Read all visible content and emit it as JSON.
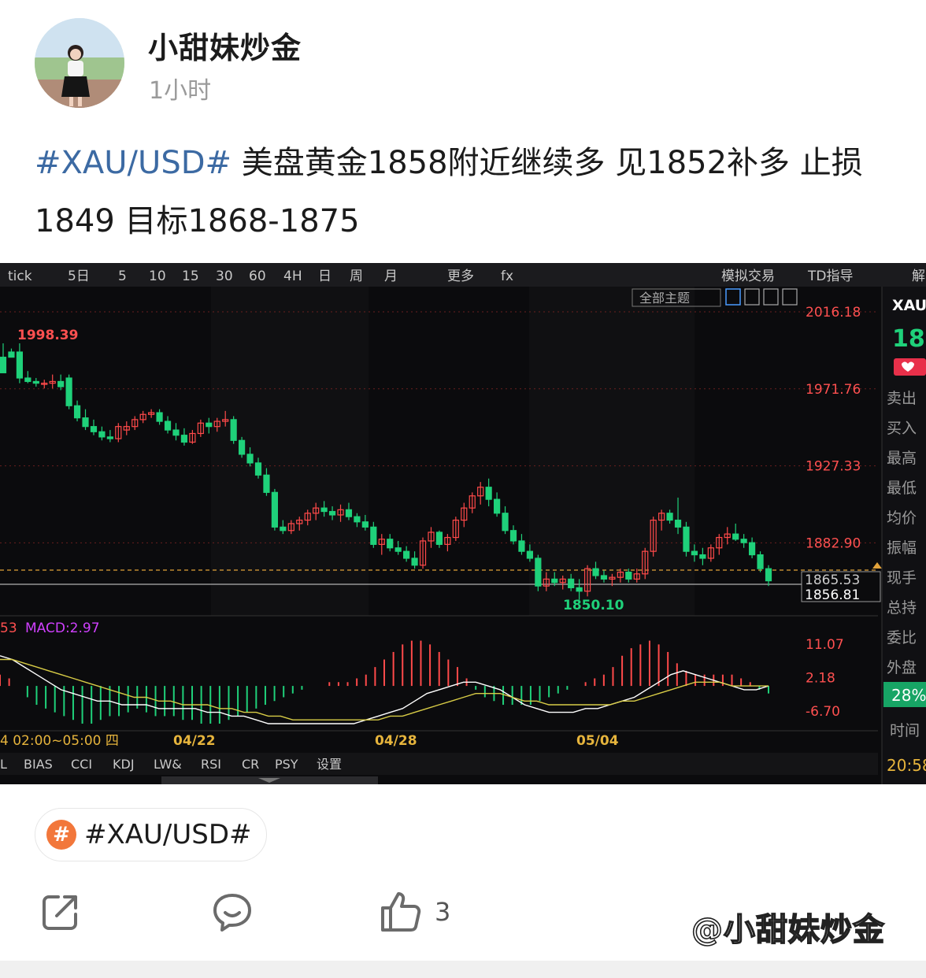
{
  "post": {
    "author": "小甜妹炒金",
    "time": "1小时",
    "hashtag": "#XAU/USD#",
    "body": " 美盘黄金1858附近继续多 见1852补多 止损1849 目标1868-1875"
  },
  "chart_toolbar": {
    "items": [
      "tick",
      "5日",
      "5",
      "10",
      "15",
      "30",
      "60",
      "4H",
      "日",
      "周",
      "月",
      "更多",
      "fx",
      "模拟交易",
      "TD指导",
      "解"
    ],
    "theme_button": "全部主题"
  },
  "chart_data": {
    "type": "candlestick",
    "symbol": "XAU",
    "price_axis_labels": [
      "2016.18",
      "1971.76",
      "1927.33",
      "1882.90"
    ],
    "current_price_label": "1865.53",
    "reference_price_label": "1856.81",
    "high_label": "1998.39",
    "low_label": "1850.10",
    "x_tick_labels": [
      "04/22",
      "04/28",
      "05/04"
    ],
    "time_range_label": "4 02:00~05:00 四",
    "macd_label": "MACD:2.97",
    "macd_left_value": "53",
    "macd_axis_labels": [
      "11.07",
      "2.18",
      "-6.70"
    ],
    "side_panel": {
      "symbol": "XAU",
      "price_partial": "18",
      "labels": [
        "卖出",
        "买入",
        "最高",
        "最低",
        "均价",
        "振幅",
        "现手",
        "总持",
        "委比",
        "外盘"
      ],
      "percent": "28%",
      "time_label": "时间",
      "time_value": "20:58"
    },
    "indicator_tabs": [
      "L",
      "BIAS",
      "CCI",
      "KDJ",
      "LW&",
      "RSI",
      "CR",
      "PSY",
      "设置"
    ],
    "candles": [
      [
        1990,
        1998,
        1985,
        1981
      ],
      [
        1993,
        1995,
        1990,
        1990
      ],
      [
        1993,
        1998,
        1975,
        1978
      ],
      [
        1978,
        1982,
        1975,
        1976
      ],
      [
        1976,
        1978,
        1973,
        1975
      ],
      [
        1975,
        1977,
        1972,
        1975
      ],
      [
        1975,
        1980,
        1972,
        1976
      ],
      [
        1976,
        1980,
        1971,
        1973
      ],
      [
        1978,
        1980,
        1960,
        1962
      ],
      [
        1962,
        1965,
        1953,
        1955
      ],
      [
        1955,
        1960,
        1948,
        1950
      ],
      [
        1950,
        1954,
        1945,
        1947
      ],
      [
        1947,
        1950,
        1942,
        1944
      ],
      [
        1944,
        1948,
        1941,
        1943
      ],
      [
        1943,
        1952,
        1941,
        1950
      ],
      [
        1948,
        1953,
        1945,
        1950
      ],
      [
        1950,
        1956,
        1948,
        1954
      ],
      [
        1954,
        1959,
        1952,
        1957
      ],
      [
        1957,
        1960,
        1955,
        1958
      ],
      [
        1958,
        1960,
        1951,
        1953
      ],
      [
        1953,
        1956,
        1946,
        1948
      ],
      [
        1948,
        1952,
        1942,
        1945
      ],
      [
        1945,
        1949,
        1939,
        1941
      ],
      [
        1941,
        1948,
        1940,
        1946
      ],
      [
        1946,
        1954,
        1944,
        1952
      ],
      [
        1952,
        1955,
        1946,
        1950
      ],
      [
        1950,
        1955,
        1947,
        1953
      ],
      [
        1953,
        1959,
        1950,
        1954
      ],
      [
        1954,
        1956,
        1940,
        1942
      ],
      [
        1942,
        1944,
        1932,
        1934
      ],
      [
        1934,
        1938,
        1927,
        1929
      ],
      [
        1929,
        1932,
        1920,
        1922
      ],
      [
        1922,
        1926,
        1910,
        1912
      ],
      [
        1912,
        1914,
        1890,
        1892
      ],
      [
        1892,
        1896,
        1888,
        1890
      ],
      [
        1890,
        1896,
        1888,
        1894
      ],
      [
        1894,
        1898,
        1890,
        1896
      ],
      [
        1896,
        1902,
        1893,
        1900
      ],
      [
        1900,
        1906,
        1896,
        1903
      ],
      [
        1903,
        1907,
        1898,
        1901
      ],
      [
        1901,
        1904,
        1896,
        1899
      ],
      [
        1899,
        1905,
        1895,
        1902
      ],
      [
        1902,
        1906,
        1896,
        1898
      ],
      [
        1898,
        1900,
        1892,
        1895
      ],
      [
        1895,
        1899,
        1890,
        1892
      ],
      [
        1892,
        1895,
        1880,
        1882
      ],
      [
        1882,
        1888,
        1876,
        1885
      ],
      [
        1885,
        1888,
        1878,
        1880
      ],
      [
        1880,
        1884,
        1876,
        1878
      ],
      [
        1878,
        1881,
        1872,
        1874
      ],
      [
        1874,
        1878,
        1868,
        1870
      ],
      [
        1870,
        1886,
        1868,
        1884
      ],
      [
        1884,
        1892,
        1880,
        1889
      ],
      [
        1889,
        1890,
        1880,
        1882
      ],
      [
        1882,
        1888,
        1878,
        1886
      ],
      [
        1886,
        1898,
        1884,
        1896
      ],
      [
        1896,
        1906,
        1892,
        1903
      ],
      [
        1903,
        1912,
        1900,
        1910
      ],
      [
        1910,
        1918,
        1905,
        1915
      ],
      [
        1915,
        1920,
        1904,
        1908
      ],
      [
        1908,
        1912,
        1898,
        1900
      ],
      [
        1900,
        1904,
        1888,
        1890
      ],
      [
        1890,
        1893,
        1882,
        1884
      ],
      [
        1884,
        1888,
        1876,
        1878
      ],
      [
        1878,
        1882,
        1872,
        1874
      ],
      [
        1874,
        1876,
        1855,
        1858
      ],
      [
        1858,
        1866,
        1855,
        1862
      ],
      [
        1862,
        1866,
        1858,
        1860
      ],
      [
        1860,
        1864,
        1856,
        1862
      ],
      [
        1862,
        1865,
        1855,
        1857
      ],
      [
        1857,
        1862,
        1850,
        1855
      ],
      [
        1855,
        1870,
        1852,
        1868
      ],
      [
        1868,
        1872,
        1862,
        1864
      ],
      [
        1864,
        1867,
        1860,
        1862
      ],
      [
        1862,
        1865,
        1858,
        1863
      ],
      [
        1863,
        1868,
        1860,
        1866
      ],
      [
        1866,
        1868,
        1860,
        1862
      ],
      [
        1862,
        1868,
        1860,
        1865
      ],
      [
        1865,
        1880,
        1862,
        1878
      ],
      [
        1878,
        1898,
        1875,
        1896
      ],
      [
        1896,
        1902,
        1890,
        1900
      ],
      [
        1900,
        1902,
        1894,
        1896
      ],
      [
        1896,
        1909,
        1888,
        1892
      ],
      [
        1892,
        1895,
        1875,
        1878
      ],
      [
        1878,
        1882,
        1872,
        1876
      ],
      [
        1876,
        1880,
        1870,
        1874
      ],
      [
        1874,
        1882,
        1872,
        1880
      ],
      [
        1880,
        1888,
        1876,
        1886
      ],
      [
        1886,
        1892,
        1882,
        1888
      ],
      [
        1888,
        1894,
        1884,
        1885
      ],
      [
        1885,
        1888,
        1880,
        1883
      ],
      [
        1883,
        1886,
        1874,
        1876
      ],
      [
        1876,
        1878,
        1866,
        1868
      ],
      [
        1868,
        1870,
        1858,
        1861
      ]
    ],
    "macd_hist": [
      3,
      2,
      0,
      -3,
      -5,
      -6,
      -7,
      -8,
      -9,
      -10,
      -10,
      -9,
      -8,
      -8,
      -7,
      -6,
      -7,
      -8,
      -8,
      -8,
      -9,
      -9,
      -10,
      -10,
      -10,
      -9,
      -8,
      -7,
      -6,
      -5,
      -4,
      -3,
      -2,
      -1,
      0,
      0,
      1,
      1,
      1,
      2,
      3,
      5,
      7,
      9,
      11,
      12,
      12,
      11,
      9,
      7,
      5,
      2,
      -1,
      -3,
      -4,
      -5,
      -5,
      -5,
      -5,
      -4,
      -3,
      -2,
      -1,
      0,
      1,
      2,
      3,
      5,
      8,
      10,
      11,
      12,
      11,
      9,
      6,
      4,
      3,
      3,
      3,
      3,
      3,
      2,
      1,
      -1,
      -2
    ],
    "macd_dif": [
      8,
      7,
      5,
      3,
      1,
      -1,
      -2,
      -3,
      -4,
      -4,
      -5,
      -5,
      -5,
      -6,
      -6,
      -6,
      -6,
      -7,
      -7,
      -8,
      -8,
      -9,
      -10,
      -10,
      -10,
      -10,
      -10,
      -10,
      -10,
      -10,
      -9,
      -8,
      -7,
      -6,
      -4,
      -2,
      -1,
      0,
      1,
      1,
      0,
      -1,
      -3,
      -5,
      -6,
      -7,
      -7,
      -7,
      -6,
      -6,
      -5,
      -4,
      -3,
      -1,
      1,
      3,
      4,
      3,
      2,
      1,
      0,
      -1,
      -1,
      0
    ],
    "macd_dea": [
      7,
      7,
      6,
      5,
      4,
      3,
      2,
      1,
      0,
      -1,
      -2,
      -3,
      -3,
      -4,
      -4,
      -5,
      -5,
      -5,
      -6,
      -6,
      -7,
      -7,
      -8,
      -8,
      -9,
      -9,
      -9,
      -9,
      -9,
      -9,
      -9,
      -9,
      -8,
      -8,
      -7,
      -6,
      -5,
      -4,
      -3,
      -2,
      -2,
      -2,
      -3,
      -4,
      -4,
      -5,
      -5,
      -5,
      -5,
      -5,
      -5,
      -4,
      -4,
      -3,
      -2,
      -1,
      0,
      1,
      1,
      1,
      0,
      0,
      0,
      0
    ]
  },
  "topic": {
    "label": "#XAU/USD#",
    "icon": "#"
  },
  "actions": {
    "like_count": "3"
  },
  "watermark": "@小甜妹炒金",
  "colors": {
    "up": "#ff4a4a",
    "down": "#1fd17a",
    "hashtag": "#3c6aa3",
    "topic_icon": "#f2773b"
  }
}
